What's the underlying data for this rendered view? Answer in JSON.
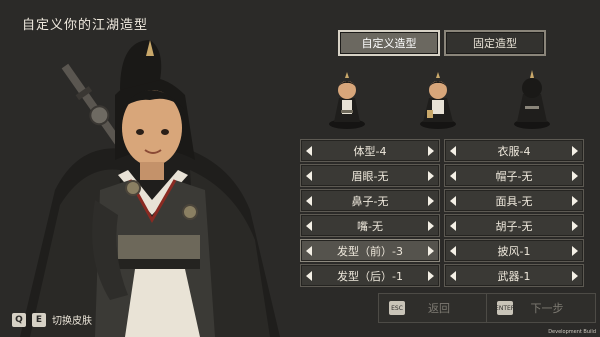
{
  "title": "自定义你的江湖造型",
  "mode_tabs": [
    {
      "label": "自定义造型",
      "active": true
    },
    {
      "label": "固定造型",
      "active": false
    }
  ],
  "options_left": [
    {
      "label": "体型-4",
      "selected": false
    },
    {
      "label": "眉眼-无",
      "selected": false
    },
    {
      "label": "鼻子-无",
      "selected": false
    },
    {
      "label": "嘴-无",
      "selected": false
    },
    {
      "label": "发型（前）-3",
      "selected": true
    },
    {
      "label": "发型（后）-1",
      "selected": false
    }
  ],
  "options_right": [
    {
      "label": "衣服-4",
      "selected": false
    },
    {
      "label": "帽子-无",
      "selected": false
    },
    {
      "label": "面具-无",
      "selected": false
    },
    {
      "label": "胡子-无",
      "selected": false
    },
    {
      "label": "披风-1",
      "selected": false
    },
    {
      "label": "武器-1",
      "selected": false
    }
  ],
  "back_button": {
    "key": "ESC",
    "label": "返回"
  },
  "next_button": {
    "key": "ENTER",
    "label": "下一步"
  },
  "key_hint": {
    "key_q": "Q",
    "key_e": "E",
    "label": "切换皮肤"
  },
  "dev_build": "Development Build",
  "colors": {
    "background": "#2b2a28",
    "selected_row": "#55534d",
    "active_tab": "#6b6860"
  }
}
